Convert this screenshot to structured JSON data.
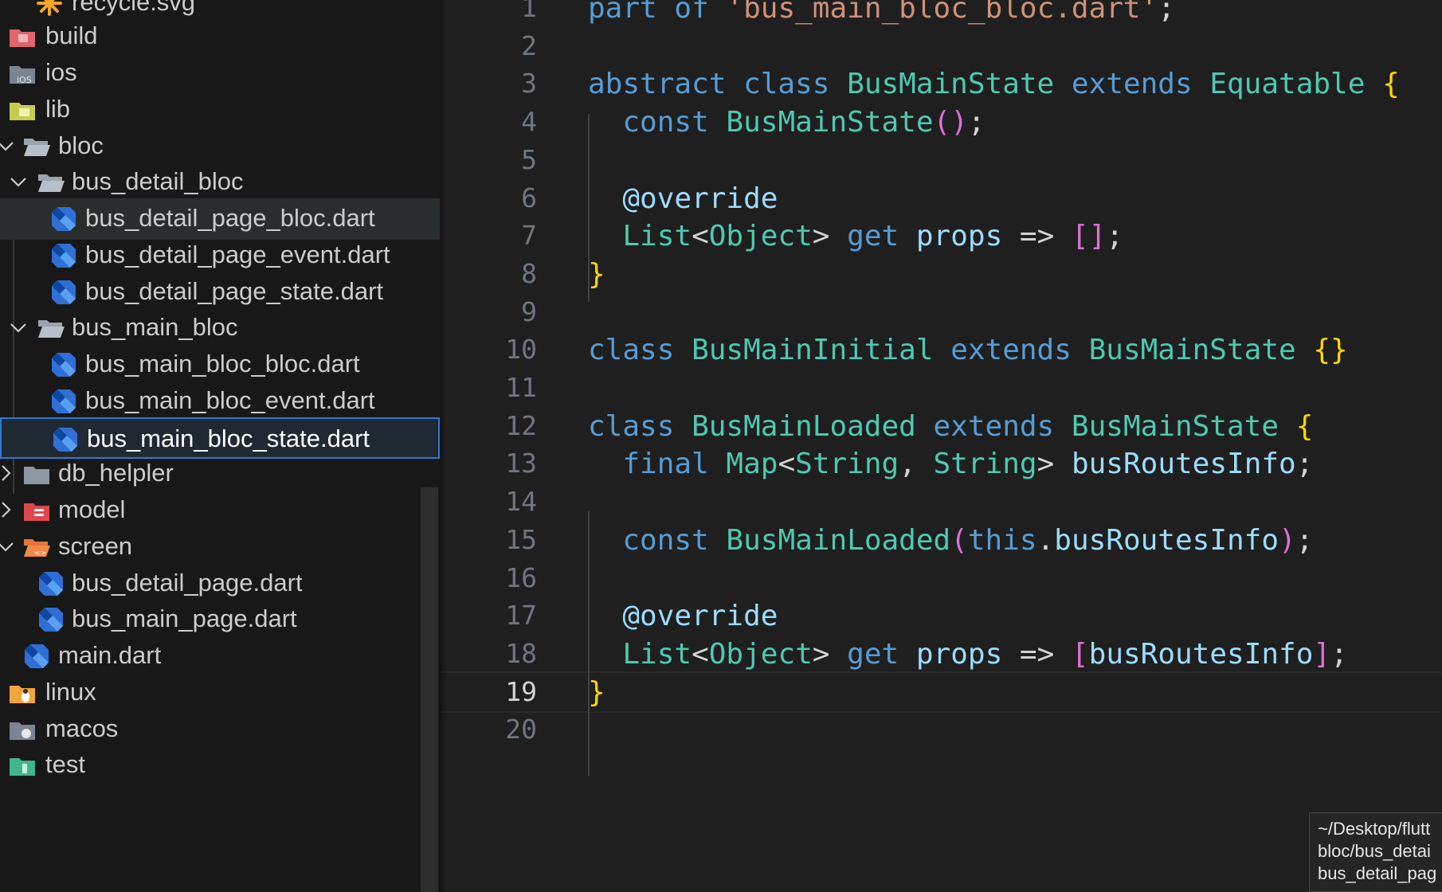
{
  "explorer": {
    "items": [
      {
        "label": "recycle.svg",
        "icon": "svg-file-icon",
        "interactable": true
      },
      {
        "label": "build",
        "icon": "build-folder-icon",
        "interactable": true
      },
      {
        "label": "ios",
        "icon": "ios-folder-icon",
        "interactable": true
      },
      {
        "label": "lib",
        "icon": "lib-folder-icon",
        "interactable": true
      },
      {
        "label": "bloc",
        "icon": "folder-open-icon",
        "twistie": "expanded"
      },
      {
        "label": "bus_detail_bloc",
        "icon": "folder-open-icon",
        "twistie": "expanded"
      },
      {
        "label": "bus_detail_page_bloc.dart",
        "icon": "dart-file-icon"
      },
      {
        "label": "bus_detail_page_event.dart",
        "icon": "dart-file-icon"
      },
      {
        "label": "bus_detail_page_state.dart",
        "icon": "dart-file-icon"
      },
      {
        "label": "bus_main_bloc",
        "icon": "folder-open-icon",
        "twistie": "expanded"
      },
      {
        "label": "bus_main_bloc_bloc.dart",
        "icon": "dart-file-icon"
      },
      {
        "label": "bus_main_bloc_event.dart",
        "icon": "dart-file-icon"
      },
      {
        "label": "bus_main_bloc_state.dart",
        "icon": "dart-file-icon",
        "state": "active"
      },
      {
        "label": "db_helpler",
        "icon": "folder-icon",
        "twistie": "collapsed"
      },
      {
        "label": "model",
        "icon": "model-folder-icon",
        "twistie": "collapsed"
      },
      {
        "label": "screen",
        "icon": "screen-folder-icon",
        "twistie": "expanded"
      },
      {
        "label": "bus_detail_page.dart",
        "icon": "dart-file-icon"
      },
      {
        "label": "bus_main_page.dart",
        "icon": "dart-file-icon"
      },
      {
        "label": "main.dart",
        "icon": "dart-file-icon"
      },
      {
        "label": "linux",
        "icon": "linux-folder-icon"
      },
      {
        "label": "macos",
        "icon": "macos-folder-icon"
      },
      {
        "label": "test",
        "icon": "test-folder-icon"
      }
    ]
  },
  "editor": {
    "current_line": 19,
    "lines": [
      {
        "n": "1",
        "tokens": [
          [
            "kw",
            "part"
          ],
          [
            "punc",
            " "
          ],
          [
            "kw",
            "of"
          ],
          [
            "punc",
            " "
          ],
          [
            "str",
            "'bus_main_bloc_bloc.dart'"
          ],
          [
            "punc",
            ";"
          ]
        ]
      },
      {
        "n": "2",
        "tokens": []
      },
      {
        "n": "3",
        "tokens": [
          [
            "kw",
            "abstract"
          ],
          [
            "punc",
            " "
          ],
          [
            "kw",
            "class"
          ],
          [
            "punc",
            " "
          ],
          [
            "ty",
            "BusMainState"
          ],
          [
            "punc",
            " "
          ],
          [
            "kw",
            "extends"
          ],
          [
            "punc",
            " "
          ],
          [
            "ty",
            "Equatable"
          ],
          [
            "punc",
            " "
          ],
          [
            "br1",
            "{"
          ]
        ]
      },
      {
        "n": "4",
        "tokens": [
          [
            "punc",
            "  "
          ],
          [
            "kw",
            "const"
          ],
          [
            "punc",
            " "
          ],
          [
            "ty",
            "BusMainState"
          ],
          [
            "br2",
            "()"
          ],
          [
            "punc",
            ";"
          ]
        ]
      },
      {
        "n": "5",
        "tokens": []
      },
      {
        "n": "6",
        "tokens": [
          [
            "punc",
            "  "
          ],
          [
            "ann",
            "@override"
          ]
        ]
      },
      {
        "n": "7",
        "tokens": [
          [
            "punc",
            "  "
          ],
          [
            "ty",
            "List"
          ],
          [
            "punc",
            "<"
          ],
          [
            "ty",
            "Object"
          ],
          [
            "punc",
            "> "
          ],
          [
            "kw",
            "get"
          ],
          [
            "punc",
            " "
          ],
          [
            "var",
            "props"
          ],
          [
            "punc",
            " => "
          ],
          [
            "br2",
            "[]"
          ],
          [
            "punc",
            ";"
          ]
        ]
      },
      {
        "n": "8",
        "tokens": [
          [
            "br1",
            "}"
          ]
        ]
      },
      {
        "n": "9",
        "tokens": []
      },
      {
        "n": "10",
        "tokens": [
          [
            "kw",
            "class"
          ],
          [
            "punc",
            " "
          ],
          [
            "ty",
            "BusMainInitial"
          ],
          [
            "punc",
            " "
          ],
          [
            "kw",
            "extends"
          ],
          [
            "punc",
            " "
          ],
          [
            "ty",
            "BusMainState"
          ],
          [
            "punc",
            " "
          ],
          [
            "br1",
            "{}"
          ]
        ]
      },
      {
        "n": "11",
        "tokens": []
      },
      {
        "n": "12",
        "tokens": [
          [
            "kw",
            "class"
          ],
          [
            "punc",
            " "
          ],
          [
            "ty",
            "BusMainLoaded"
          ],
          [
            "punc",
            " "
          ],
          [
            "kw",
            "extends"
          ],
          [
            "punc",
            " "
          ],
          [
            "ty",
            "BusMainState"
          ],
          [
            "punc",
            " "
          ],
          [
            "br1",
            "{"
          ]
        ]
      },
      {
        "n": "13",
        "tokens": [
          [
            "punc",
            "  "
          ],
          [
            "kw",
            "final"
          ],
          [
            "punc",
            " "
          ],
          [
            "ty",
            "Map"
          ],
          [
            "punc",
            "<"
          ],
          [
            "ty",
            "String"
          ],
          [
            "punc",
            ", "
          ],
          [
            "ty",
            "String"
          ],
          [
            "punc",
            "> "
          ],
          [
            "var",
            "busRoutesInfo"
          ],
          [
            "punc",
            ";"
          ]
        ]
      },
      {
        "n": "14",
        "tokens": []
      },
      {
        "n": "15",
        "tokens": [
          [
            "punc",
            "  "
          ],
          [
            "kw",
            "const"
          ],
          [
            "punc",
            " "
          ],
          [
            "ty",
            "BusMainLoaded"
          ],
          [
            "br2",
            "("
          ],
          [
            "kw",
            "this"
          ],
          [
            "punc",
            "."
          ],
          [
            "var",
            "busRoutesInfo"
          ],
          [
            "br2",
            ")"
          ],
          [
            "punc",
            ";"
          ]
        ]
      },
      {
        "n": "16",
        "tokens": []
      },
      {
        "n": "17",
        "tokens": [
          [
            "punc",
            "  "
          ],
          [
            "ann",
            "@override"
          ]
        ]
      },
      {
        "n": "18",
        "tokens": [
          [
            "punc",
            "  "
          ],
          [
            "ty",
            "List"
          ],
          [
            "punc",
            "<"
          ],
          [
            "ty",
            "Object"
          ],
          [
            "punc",
            "> "
          ],
          [
            "kw",
            "get"
          ],
          [
            "punc",
            " "
          ],
          [
            "var",
            "props"
          ],
          [
            "punc",
            " => "
          ],
          [
            "br2",
            "["
          ],
          [
            "var",
            "busRoutesInfo"
          ],
          [
            "br2",
            "]"
          ],
          [
            "punc",
            ";"
          ]
        ]
      },
      {
        "n": "19",
        "tokens": [
          [
            "br1",
            "}"
          ]
        ]
      },
      {
        "n": "20",
        "tokens": []
      }
    ]
  },
  "tooltip": {
    "lines": [
      "~/Desktop/flutt",
      "bloc/bus_detai",
      "bus_detail_pag"
    ]
  }
}
